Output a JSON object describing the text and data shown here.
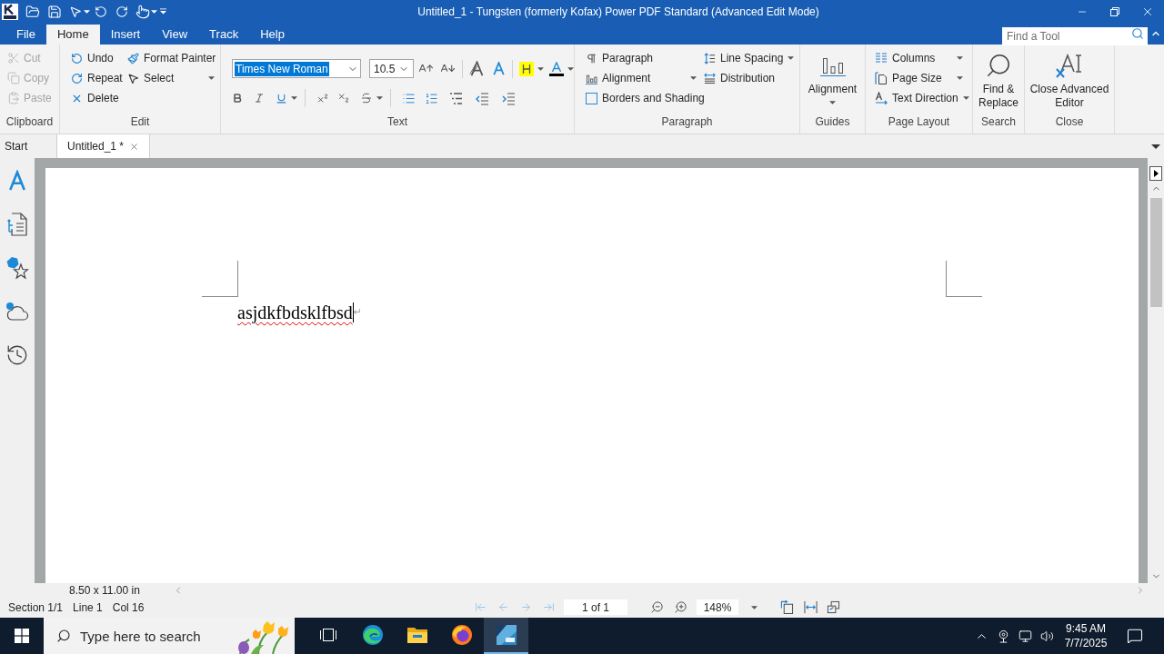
{
  "title_bar": {
    "title": "Untitled_1 - Tungsten (formerly Kofax) Power PDF Standard (Advanced Edit Mode)"
  },
  "menu_tabs": [
    {
      "label": "File",
      "selected": false
    },
    {
      "label": "Home",
      "selected": true
    },
    {
      "label": "Insert",
      "selected": false
    },
    {
      "label": "View",
      "selected": false
    },
    {
      "label": "Track",
      "selected": false
    },
    {
      "label": "Help",
      "selected": false
    }
  ],
  "find_tool": {
    "placeholder": "Find a Tool"
  },
  "ribbon": {
    "clipboard": {
      "label": "Clipboard",
      "items": [
        {
          "label": "Cut",
          "disabled": true
        },
        {
          "label": "Copy",
          "disabled": true
        },
        {
          "label": "Paste",
          "disabled": true
        }
      ]
    },
    "edit": {
      "label": "Edit",
      "items": [
        {
          "label": "Undo",
          "dropdown": false
        },
        {
          "label": "Format Painter",
          "dropdown": false
        },
        {
          "label": "Repeat",
          "dropdown": false
        },
        {
          "label": "Select",
          "dropdown": true
        },
        {
          "label": "Delete",
          "dropdown": false
        }
      ]
    },
    "text": {
      "label": "Text",
      "font": {
        "value": "Times New Roman",
        "text_selected": true
      },
      "size": {
        "value": "10.5"
      }
    },
    "paragraph": {
      "label": "Paragraph",
      "items": [
        {
          "label": "Paragraph",
          "dropdown": false
        },
        {
          "label": "Line Spacing",
          "dropdown": true
        },
        {
          "label": "Alignment",
          "dropdown": true
        },
        {
          "label": "Distribution",
          "dropdown": false
        },
        {
          "label": "Borders and Shading",
          "dropdown": false
        }
      ]
    },
    "guides": {
      "label": "Guides",
      "button": {
        "label": "Alignment",
        "dropdown": true
      }
    },
    "page_layout": {
      "label": "Page Layout",
      "items": [
        {
          "label": "Columns",
          "dropdown": true
        },
        {
          "label": "Page Size",
          "dropdown": true
        },
        {
          "label": "Text Direction",
          "dropdown": true
        }
      ]
    },
    "search": {
      "label": "Search",
      "button": {
        "label": "Find & Replace"
      }
    },
    "close": {
      "label": "Close",
      "button": {
        "label": "Close Advanced Editor"
      }
    }
  },
  "document_tabs": [
    {
      "label": "Start",
      "selected": false,
      "closable": false
    },
    {
      "label": "Untitled_1 *",
      "selected": true,
      "closable": true
    }
  ],
  "document": {
    "text": "asjdkfbdsklfbsd",
    "spelling_error": true,
    "paragraph_mark": "↵"
  },
  "page_size": "8.50 x 11.00 in",
  "status_bar": {
    "section": "Section 1/1",
    "line": "Line 1",
    "column": "Col 16",
    "page_field": "1 of 1",
    "zoom_field": "148%"
  },
  "taskbar": {
    "search": {
      "placeholder": "Type here to search"
    },
    "apps": [
      {
        "kind": "task_view",
        "selected": false
      },
      {
        "kind": "edge",
        "selected": false
      },
      {
        "kind": "file_explorer",
        "selected": false
      },
      {
        "kind": "firefox",
        "selected": false
      },
      {
        "kind": "power_pdf",
        "selected": true
      }
    ],
    "time": "9:45 AM",
    "date": "7/7/2025"
  }
}
